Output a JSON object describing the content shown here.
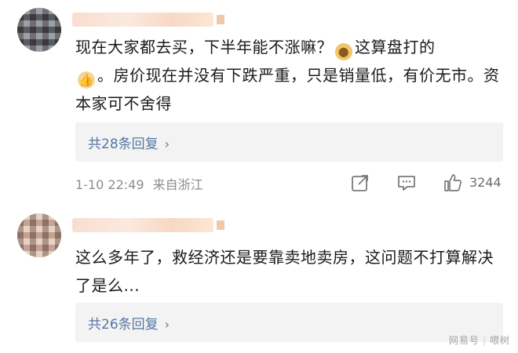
{
  "comments": [
    {
      "text_before_emoji": "现在大家都去买，下半年能不涨嘛？",
      "emoji1": "doge-emoji",
      "text_mid": "这算盘打的",
      "emoji2": "thumbs-up-emoji",
      "text_after": "。房价现在并没有下跌严重，只是销量低，有价无市。资本家可不舍得",
      "replies_label": "共28条回复",
      "timestamp": "1-10 22:49",
      "source": "来自浙江",
      "like_count": "3244"
    },
    {
      "text": "这么多年了，救经济还是要靠卖地卖房，这问题不打算解决了是么...",
      "replies_label": "共26条回复"
    }
  ],
  "watermark": {
    "brand": "网易号",
    "account": "喂树"
  },
  "colors": {
    "link": "#5676a5",
    "meta": "#8c8c8c",
    "reply_bg": "#f3f3f3"
  }
}
